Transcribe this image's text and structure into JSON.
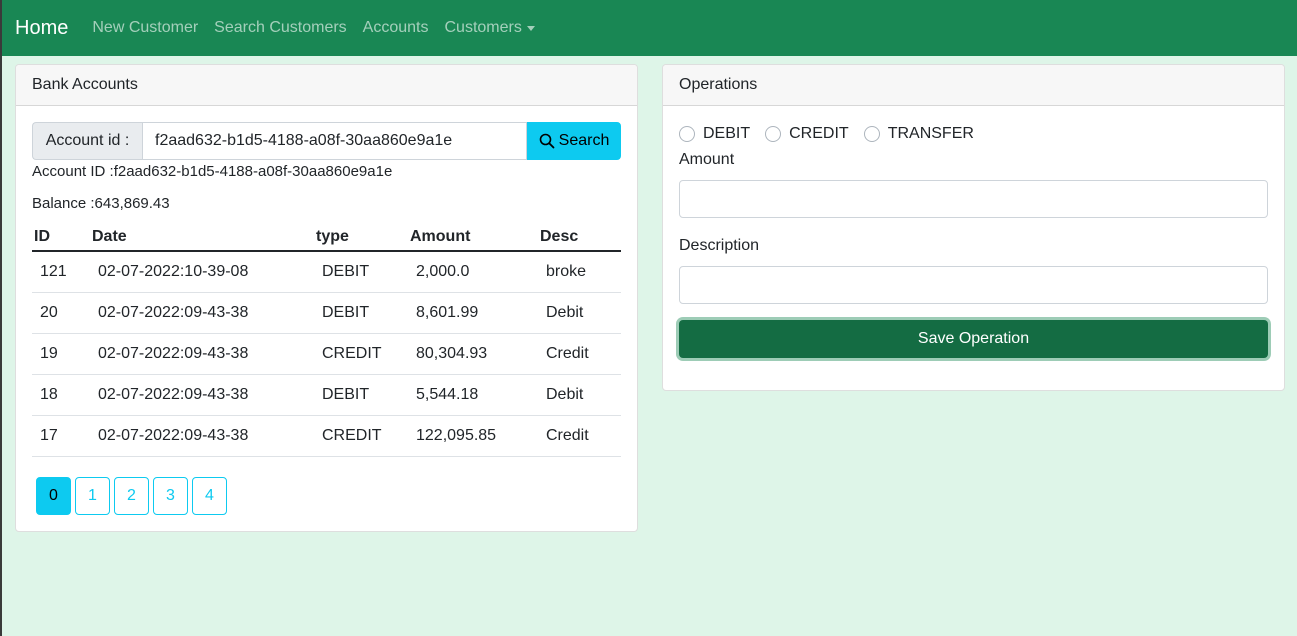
{
  "navbar": {
    "brand": "Home",
    "links": [
      "New Customer",
      "Search Customers",
      "Accounts",
      "Customers"
    ]
  },
  "accounts_card": {
    "title": "Bank Accounts",
    "search": {
      "label": "Account id :",
      "value": "f2aad632-b1d5-4188-a08f-30aa860e9a1e",
      "button": "Search"
    },
    "account_id_line": "Account ID :f2aad632-b1d5-4188-a08f-30aa860e9a1e",
    "balance_line": "Balance :643,869.43",
    "table": {
      "headers": [
        "ID",
        "Date",
        "type",
        "Amount",
        "Desc"
      ],
      "rows": [
        [
          "121",
          "02-07-2022:10-39-08",
          "DEBIT",
          "2,000.0",
          "broke"
        ],
        [
          "20",
          "02-07-2022:09-43-38",
          "DEBIT",
          "8,601.99",
          "Debit"
        ],
        [
          "19",
          "02-07-2022:09-43-38",
          "CREDIT",
          "80,304.93",
          "Credit"
        ],
        [
          "18",
          "02-07-2022:09-43-38",
          "DEBIT",
          "5,544.18",
          "Debit"
        ],
        [
          "17",
          "02-07-2022:09-43-38",
          "CREDIT",
          "122,095.85",
          "Credit"
        ]
      ]
    },
    "pages": [
      "0",
      "1",
      "2",
      "3",
      "4"
    ],
    "active_page": "0"
  },
  "operations_card": {
    "title": "Operations",
    "options": [
      "DEBIT",
      "CREDIT",
      "TRANSFER"
    ],
    "amount_label": "Amount",
    "amount_value": "",
    "description_label": "Description",
    "description_value": "",
    "submit": "Save Operation"
  },
  "colors": {
    "navbar": "#198754",
    "background": "#def5e8",
    "info": "#0dcaf0",
    "save_button": "#146c43"
  }
}
